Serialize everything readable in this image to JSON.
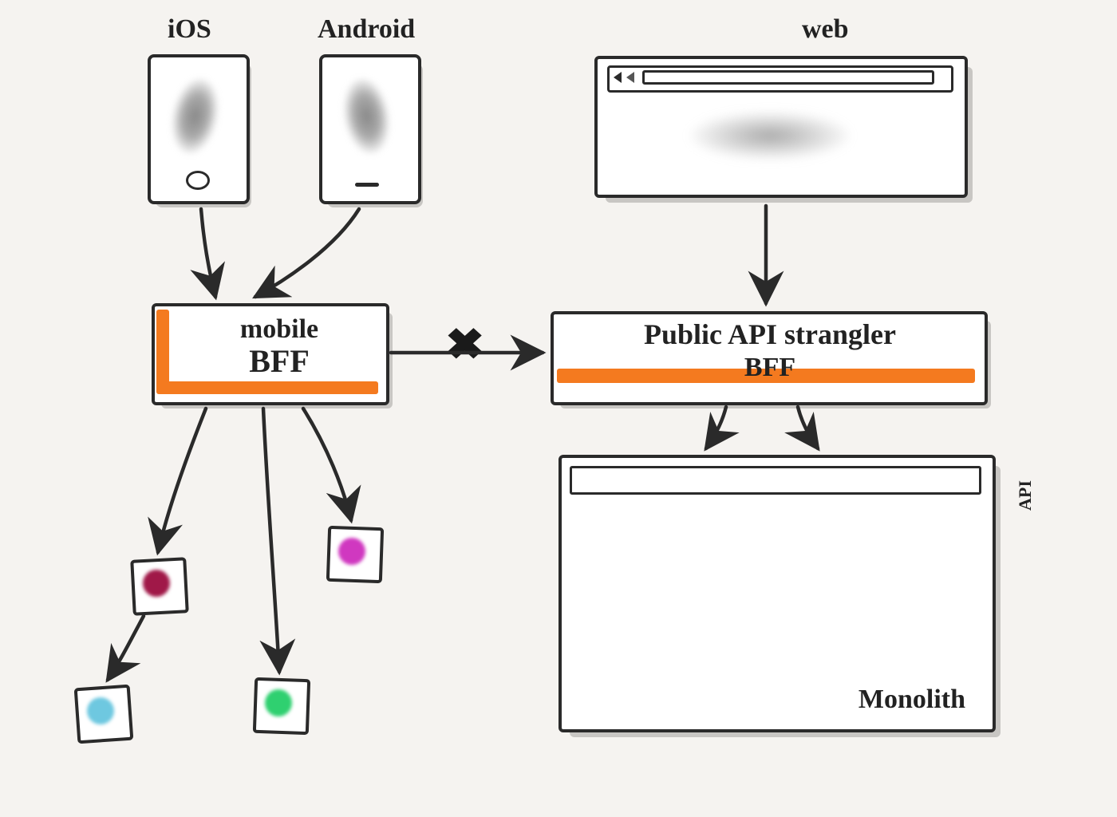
{
  "labels": {
    "ios": "iOS",
    "android": "Android",
    "web": "web",
    "mobile_bff_line1": "mobile",
    "mobile_bff_line2": "BFF",
    "public_bff_line1": "Public API strangler",
    "public_bff_line2": "BFF",
    "monolith": "Monolith",
    "api": "API",
    "cross": "✖"
  },
  "colors": {
    "orange": "#f47a1f",
    "service_red": "#a01848",
    "service_magenta": "#d038c0",
    "service_blue": "#6ec8e0",
    "service_green": "#2fd070"
  },
  "diagram": {
    "nodes": [
      {
        "id": "ios-device",
        "type": "phone",
        "label_key": "ios"
      },
      {
        "id": "android-device",
        "type": "phone",
        "label_key": "android"
      },
      {
        "id": "web-browser",
        "type": "browser",
        "label_key": "web"
      },
      {
        "id": "mobile-bff",
        "type": "bff"
      },
      {
        "id": "public-api-bff",
        "type": "bff"
      },
      {
        "id": "monolith",
        "type": "monolith",
        "label_key": "monolith",
        "api_label_key": "api"
      },
      {
        "id": "service-red",
        "type": "microservice",
        "color_key": "service_red"
      },
      {
        "id": "service-magenta",
        "type": "microservice",
        "color_key": "service_magenta"
      },
      {
        "id": "service-blue",
        "type": "microservice",
        "color_key": "service_blue"
      },
      {
        "id": "service-green",
        "type": "microservice",
        "color_key": "service_green"
      }
    ],
    "edges": [
      {
        "from": "ios-device",
        "to": "mobile-bff"
      },
      {
        "from": "android-device",
        "to": "mobile-bff"
      },
      {
        "from": "web-browser",
        "to": "public-api-bff"
      },
      {
        "from": "mobile-bff",
        "to": "public-api-bff",
        "blocked": true
      },
      {
        "from": "mobile-bff",
        "to": "service-red"
      },
      {
        "from": "mobile-bff",
        "to": "service-green"
      },
      {
        "from": "mobile-bff",
        "to": "service-magenta"
      },
      {
        "from": "service-red",
        "to": "service-blue"
      },
      {
        "from": "public-api-bff",
        "to": "monolith",
        "count": 2
      }
    ]
  }
}
